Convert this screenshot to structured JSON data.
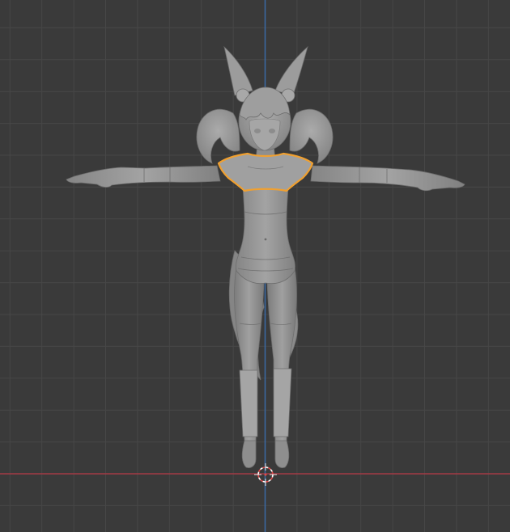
{
  "viewport": {
    "background_color": "#3a3a3a",
    "grid_color": "#474747",
    "x_axis_color": "#a23a45",
    "y_axis_color": "#3a6aa5",
    "selection_outline_color": "#f0a030",
    "mesh_color": "#9a9a9a",
    "mesh_shadow_color": "#7a7a7a",
    "cursor_colors": [
      "#e04a4a",
      "#ffffff"
    ],
    "objects": [
      {
        "name": "character-mesh",
        "selected": false
      },
      {
        "name": "shirt-mesh",
        "selected": true
      }
    ],
    "cursor_icon": "3d-cursor-icon"
  }
}
